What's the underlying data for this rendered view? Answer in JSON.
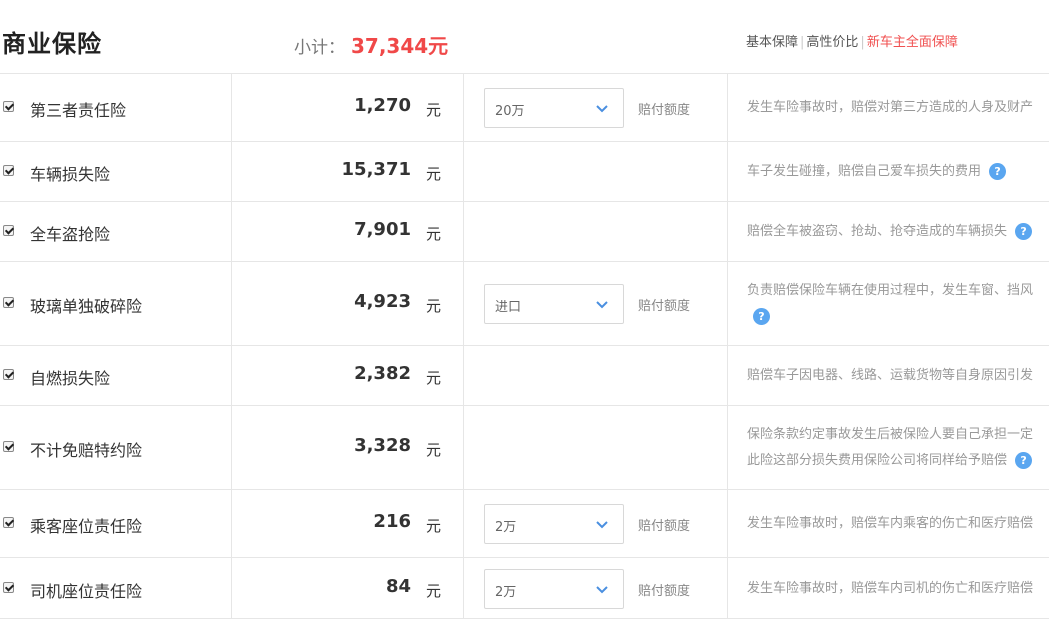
{
  "header": {
    "title": "商业保险",
    "subtotal_label": "小计：",
    "subtotal_value": "37,344元",
    "plans": [
      "基本保障",
      "高性价比",
      "新车主全面保障"
    ]
  },
  "unit": "元",
  "pay_label": "赔付额度",
  "items": [
    {
      "name": "第三者责任险",
      "price": "1,270",
      "select": "20万",
      "desc": [
        "发生车险事故时，赔偿对第三方造成的人身及财产"
      ]
    },
    {
      "name": "车辆损失险",
      "price": "15,371",
      "desc": [
        "车子发生碰撞，赔偿自己爱车损失的费用"
      ]
    },
    {
      "name": "全车盗抢险",
      "price": "7,901",
      "desc": [
        "赔偿全车被盗窃、抢劫、抢夺造成的车辆损失"
      ]
    },
    {
      "name": "玻璃单独破碎险",
      "price": "4,923",
      "select": "进口",
      "desc": [
        "负责赔偿保险车辆在使用过程中，发生车窗、挡风"
      ]
    },
    {
      "name": "自燃损失险",
      "price": "2,382",
      "desc": [
        "赔偿车子因电器、线路、运载货物等自身原因引发"
      ]
    },
    {
      "name": "不计免赔特约险",
      "price": "3,328",
      "desc": [
        "保险条款约定事故发生后被保险人要自己承担一定",
        "此险这部分损失费用保险公司将同样给予赔偿"
      ]
    },
    {
      "name": "乘客座位责任险",
      "price": "216",
      "select": "2万",
      "desc": [
        "发生车险事故时，赔偿车内乘客的伤亡和医疗赔偿"
      ]
    },
    {
      "name": "司机座位责任险",
      "price": "84",
      "select": "2万",
      "desc": [
        "发生车险事故时，赔偿车内司机的伤亡和医疗赔偿"
      ]
    }
  ]
}
